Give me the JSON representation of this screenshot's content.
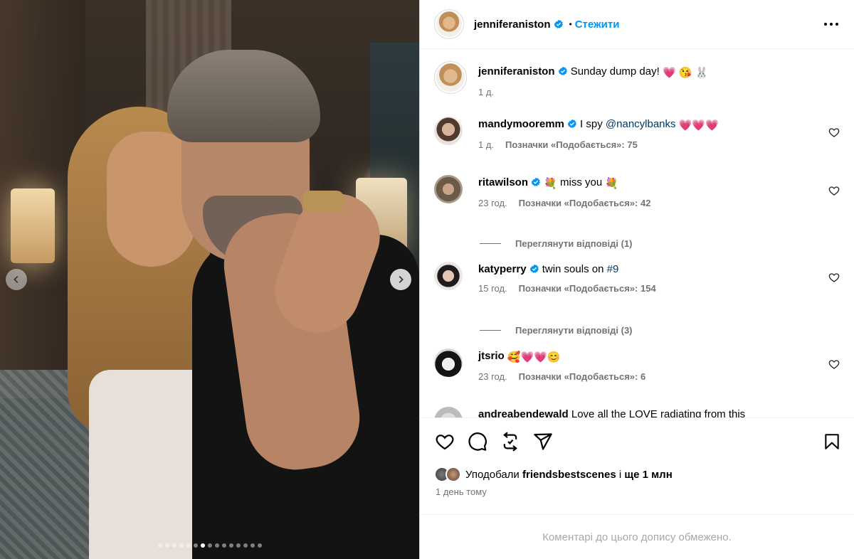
{
  "post": {
    "author": "jenniferaniston",
    "follow_label": "Стежити",
    "separator": "•",
    "caption": "Sunday dump day!",
    "caption_time": "1 д."
  },
  "carousel": {
    "slide_count": 15,
    "active_index": 6
  },
  "comments": [
    {
      "user": "mandymooremm",
      "verified": true,
      "text_before": "I spy",
      "mention": "@nancylbanks",
      "time": "1 д.",
      "likes": "Позначки «Подобається»: 75"
    },
    {
      "user": "ritawilson",
      "verified": true,
      "text": "miss you",
      "time": "23 год.",
      "likes": "Позначки «Подобається»: 42",
      "replies": "Переглянути відповіді (1)"
    },
    {
      "user": "katyperry",
      "verified": true,
      "text_before": "twin souls on",
      "mention": "#9",
      "time": "15 год.",
      "likes": "Позначки «Подобається»: 154",
      "replies": "Переглянути відповіді (3)"
    },
    {
      "user": "jtsrio",
      "verified": false,
      "time": "23 год.",
      "likes": "Позначки «Подобається»: 6"
    },
    {
      "user": "andreabendewald",
      "text": "Love all the LOVE radiating from this"
    }
  ],
  "likes_summary": {
    "prefix": "Уподобали",
    "user": "friendsbestscenes",
    "middle": "і",
    "count": "ще 1 млн"
  },
  "post_date": "1 день тому",
  "comments_limited": "Коментарі до цього допису обмежено.",
  "icons": {
    "like": "heart-icon",
    "comment": "comment-icon",
    "repost": "repost-icon",
    "share": "share-icon",
    "save": "bookmark-icon",
    "more": "more-icon"
  },
  "colors": {
    "accent": "#0095f6",
    "verified": "#0095f6",
    "secondary_text": "#737373"
  }
}
